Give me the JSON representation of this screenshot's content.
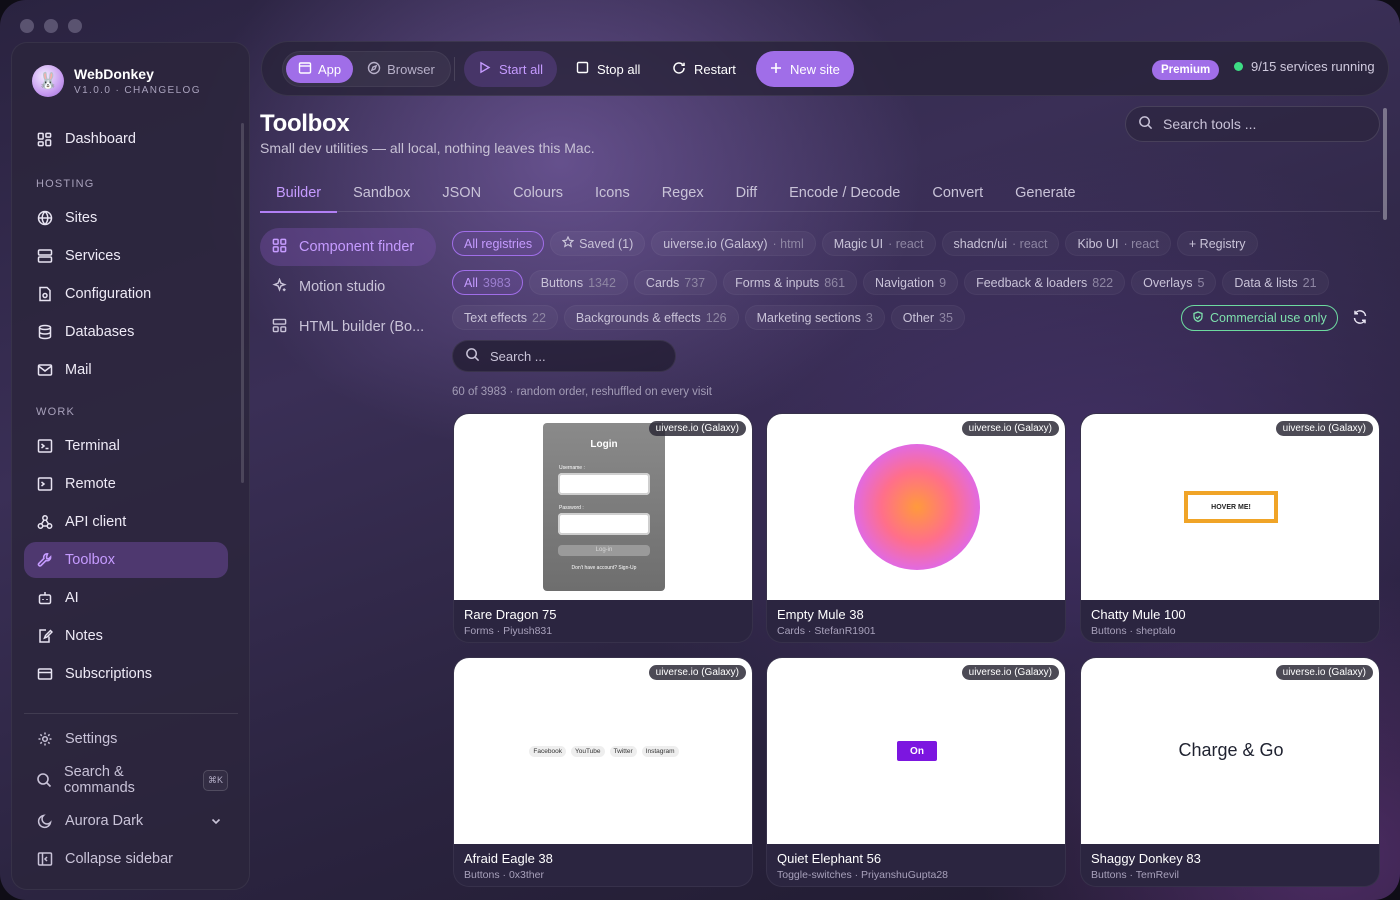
{
  "brand": {
    "name": "WebDonkey",
    "version": "V1.0.0 · CHANGELOG"
  },
  "sidebar": {
    "dashboard": "Dashboard",
    "sections": {
      "hosting": "HOSTING",
      "work": "WORK"
    },
    "hosting_items": [
      "Sites",
      "Services",
      "Configuration",
      "Databases",
      "Mail"
    ],
    "work_items": [
      "Terminal",
      "Remote",
      "API client",
      "Toolbox",
      "AI",
      "Notes",
      "Subscriptions"
    ],
    "footer": {
      "settings": "Settings",
      "search": "Search & commands",
      "search_kbd": "⌘K",
      "theme": "Aurora Dark",
      "collapse": "Collapse sidebar"
    }
  },
  "topbar": {
    "app": "App",
    "browser": "Browser",
    "start_all": "Start all",
    "stop_all": "Stop all",
    "restart": "Restart",
    "new_site": "New site",
    "premium": "Premium",
    "status": "9/15 services running",
    "accent": "#a06ee8",
    "status_color": "#3ddc84"
  },
  "header": {
    "title": "Toolbox",
    "subtitle": "Small dev utilities — all local, nothing leaves this Mac.",
    "search_placeholder": "Search tools ..."
  },
  "tabs": [
    "Builder",
    "Sandbox",
    "JSON",
    "Colours",
    "Icons",
    "Regex",
    "Diff",
    "Encode / Decode",
    "Convert",
    "Generate"
  ],
  "subnav": [
    "Component finder",
    "Motion studio",
    "HTML builder (Bo..."
  ],
  "registries": [
    {
      "label": "All registries",
      "tag": ""
    },
    {
      "label": "Saved (1)",
      "tag": ""
    },
    {
      "label": "uiverse.io (Galaxy)",
      "tag": "· html"
    },
    {
      "label": "Magic UI",
      "tag": "· react"
    },
    {
      "label": "shadcn/ui",
      "tag": "· react"
    },
    {
      "label": "Kibo UI",
      "tag": "· react"
    },
    {
      "label": "+ Registry",
      "tag": ""
    }
  ],
  "categories_row1": [
    {
      "label": "All",
      "count": "3983"
    },
    {
      "label": "Buttons",
      "count": "1342"
    },
    {
      "label": "Cards",
      "count": "737"
    },
    {
      "label": "Forms & inputs",
      "count": "861"
    },
    {
      "label": "Navigation",
      "count": "9"
    },
    {
      "label": "Feedback & loaders",
      "count": "822"
    },
    {
      "label": "Overlays",
      "count": "5"
    },
    {
      "label": "Data & lists",
      "count": "21"
    }
  ],
  "categories_row2": [
    {
      "label": "Text effects",
      "count": "22"
    },
    {
      "label": "Backgrounds & effects",
      "count": "126"
    },
    {
      "label": "Marketing sections",
      "count": "3"
    },
    {
      "label": "Other",
      "count": "35"
    }
  ],
  "commercial": "Commercial use only",
  "finder_search_placeholder": "Search ...",
  "result_count": "60 of 3983 · random order, reshuffled on every visit",
  "cards": [
    {
      "badge": "uiverse.io (Galaxy)",
      "name": "Rare Dragon 75",
      "meta": "Forms · Piyush831",
      "preview": {
        "title": "Login",
        "username": "Username :",
        "password": "Password :",
        "button": "Log-in",
        "footer": "Don't have account? Sign-Up"
      }
    },
    {
      "badge": "uiverse.io (Galaxy)",
      "name": "Empty Mule 38",
      "meta": "Cards · StefanR1901"
    },
    {
      "badge": "uiverse.io (Galaxy)",
      "name": "Chatty Mule 100",
      "meta": "Buttons · sheptalo",
      "preview": {
        "button": "HOVER ME!"
      }
    },
    {
      "badge": "uiverse.io (Galaxy)",
      "name": "Afraid Eagle 38",
      "meta": "Buttons · 0x3ther",
      "preview": {
        "links": [
          "Facebook",
          "YouTube",
          "Twitter",
          "Instagram"
        ]
      }
    },
    {
      "badge": "uiverse.io (Galaxy)",
      "name": "Quiet Elephant 56",
      "meta": "Toggle-switches · PriyanshuGupta28",
      "preview": {
        "toggle": "On"
      }
    },
    {
      "badge": "uiverse.io (Galaxy)",
      "name": "Shaggy Donkey 83",
      "meta": "Buttons · TemRevil",
      "preview": {
        "text": "Charge & Go"
      }
    }
  ]
}
